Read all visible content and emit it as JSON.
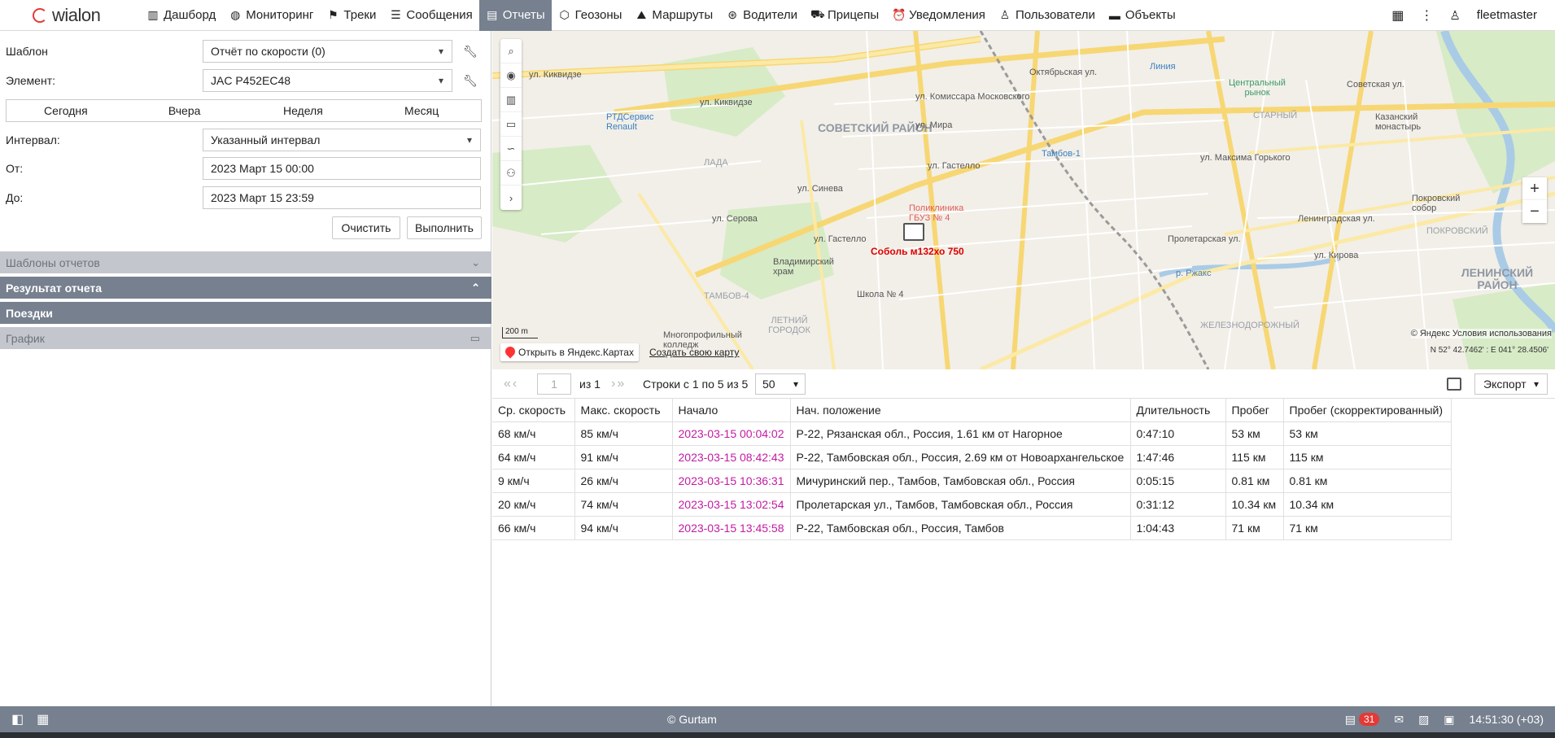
{
  "brand": {
    "name": "wialon"
  },
  "nav": {
    "items": [
      {
        "label": "Дашборд",
        "icon": "dashboard-icon",
        "glyph": "▥"
      },
      {
        "label": "Мониторинг",
        "icon": "globe-icon",
        "glyph": "◍"
      },
      {
        "label": "Треки",
        "icon": "flag-icon",
        "glyph": "⚑"
      },
      {
        "label": "Сообщения",
        "icon": "messages-icon",
        "glyph": "☰"
      },
      {
        "label": "Отчеты",
        "icon": "reports-icon",
        "glyph": "▤"
      },
      {
        "label": "Геозоны",
        "icon": "geofence-icon",
        "glyph": "⬡"
      },
      {
        "label": "Маршруты",
        "icon": "route-icon",
        "glyph": "⛰"
      },
      {
        "label": "Водители",
        "icon": "steering-wheel-icon",
        "glyph": "⊛"
      },
      {
        "label": "Прицепы",
        "icon": "trailer-icon",
        "glyph": "⛟"
      },
      {
        "label": "Уведомления",
        "icon": "alarm-clock-icon",
        "glyph": "⏰"
      },
      {
        "label": "Пользователи",
        "icon": "user-icon",
        "glyph": "♙"
      },
      {
        "label": "Объекты",
        "icon": "bus-icon",
        "glyph": "▬"
      }
    ],
    "active_index": 4,
    "username": "fleetmaster"
  },
  "form": {
    "template_label": "Шаблон",
    "template_value": "Отчёт по скорости (0)",
    "element_label": "Элемент:",
    "element_value": "JAC P452EC48",
    "periods": [
      "Сегодня",
      "Вчера",
      "Неделя",
      "Месяц"
    ],
    "interval_label": "Интервал:",
    "interval_value": "Указанный интервал",
    "from_label": "От:",
    "from_value": "2023 Март 15 00:00",
    "to_label": "До:",
    "to_value": "2023 Март 15 23:59",
    "clear_button": "Очистить",
    "run_button": "Выполнить"
  },
  "sections": {
    "templates": "Шаблоны отчетов",
    "result": "Результат отчета",
    "trips": "Поездки",
    "chart": "График"
  },
  "map": {
    "unit_label": "Соболь м132хо 750",
    "open_yandex": "Открыть в Яндекс.Картах",
    "create_map": "Создать свою карту",
    "scale": "200 m",
    "copyright": "© Яндекс Условия использования",
    "coords": "N 52° 42.7462' : E 041° 28.4506'",
    "labels": {
      "district_soviet": "СОВЕТСКИЙ РАЙОН",
      "district_lenin": "ЛЕНИНСКИЙ РАЙОН",
      "starny": "СТАРНЫЙ",
      "lada": "ЛАДА",
      "tambov4": "ТАМБОВ-4",
      "summer_town": "ЛЕТНИЙ ГОРОДОК",
      "pokrovsky": "ПОКРОВСКИЙ",
      "railway": "ЖЕЛЕЗНОДОРОЖНЫЙ",
      "kikvidze": "ул. Киквидзе",
      "kikvidze2": "ул. Киквидзе",
      "mira": "ул. Мира",
      "gastello": "ул. Гастелло",
      "gastello2": "ул. Гастелло",
      "sineva": "ул. Синева",
      "serova": "ул. Серова",
      "moskovskogo": "ул. Комиссара Московского",
      "gorkogo": "ул. Максима Горького",
      "sovetskaya": "Советская ул.",
      "polyclinic": "Поликлиника ГБУЗ № 4",
      "school": "Школа № 4",
      "hram": "Владимирский храм",
      "mnogoprof": "Многопрофильный колледж",
      "rtd": "РТДСервис Renault",
      "liniya": "Линия",
      "market": "Центральный рынок",
      "tambov1": "Тамбов-1",
      "kazan": "Казанский монастырь",
      "pokrov_sobor": "Покровский собор",
      "oktyabrskaya": "Октябрьская ул.",
      "proletarskaya": "Пролетарская ул.",
      "leningradskaya": "Ленинградская ул.",
      "rzhaks": "р. Ржакс",
      "kirova": "ул. Кирова"
    }
  },
  "toolbar": {
    "page": "1",
    "of": "из 1",
    "rows": "Строки с 1 по 5 из 5",
    "per_page": "50",
    "export": "Экспорт"
  },
  "table": {
    "headers": [
      "Ср. скорость",
      "Макс. скорость",
      "Начало",
      "Нач. положение",
      "Длительность",
      "Пробег",
      "Пробег (скорректированный)"
    ],
    "rows": [
      [
        "68 км/ч",
        "85 км/ч",
        "2023-03-15 00:04:02",
        "Р-22, Рязанская обл., Россия, 1.61 км от Нагорное",
        "0:47:10",
        "53 км",
        "53 км"
      ],
      [
        "64 км/ч",
        "91 км/ч",
        "2023-03-15 08:42:43",
        "Р-22, Тамбовская обл., Россия, 2.69 км от Новоархангельское",
        "1:47:46",
        "115 км",
        "115 км"
      ],
      [
        "9 км/ч",
        "26 км/ч",
        "2023-03-15 10:36:31",
        "Мичуринский пер., Тамбов, Тамбовская обл., Россия",
        "0:05:15",
        "0.81 км",
        "0.81 км"
      ],
      [
        "20 км/ч",
        "74 км/ч",
        "2023-03-15 13:02:54",
        "Пролетарская ул., Тамбов, Тамбовская обл., Россия",
        "0:31:12",
        "10.34 км",
        "10.34 км"
      ],
      [
        "66 км/ч",
        "94 км/ч",
        "2023-03-15 13:45:58",
        "Р-22, Тамбовская обл., Россия, Тамбов",
        "1:04:43",
        "71 км",
        "71 км"
      ]
    ]
  },
  "statusbar": {
    "copyright": "© Gurtam",
    "badge": "31",
    "time": "14:51:30 (+03)"
  },
  "colors": {
    "accent": "#76808f",
    "time_link": "#c21ba3",
    "unit_label": "#dd0000"
  }
}
